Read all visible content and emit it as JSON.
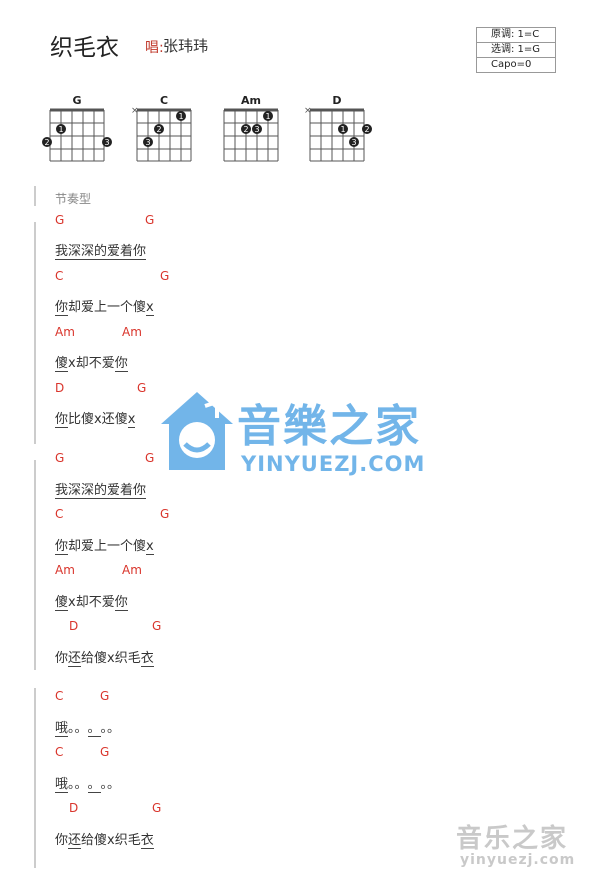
{
  "header": {
    "title": "织毛衣",
    "singer_prefix": "唱:",
    "singer": "张玮玮",
    "key_original": "原调: 1=C",
    "key_selected": "选调: 1=G",
    "capo": "Capo=0"
  },
  "chord_charts": [
    {
      "name": "G",
      "muted": "",
      "fingers": [
        "3",
        "1",
        "2",
        "3"
      ]
    },
    {
      "name": "C",
      "muted": "×",
      "fingers": [
        "1",
        "2",
        "3"
      ]
    },
    {
      "name": "Am",
      "muted": "",
      "fingers": [
        "1",
        "2",
        "3"
      ]
    },
    {
      "name": "D",
      "muted": "×",
      "fingers": [
        "1",
        "2",
        "3"
      ]
    }
  ],
  "section_label": "节奏型",
  "lines": [
    {
      "chords": [
        "G",
        "G"
      ],
      "lyric": [
        "我深深的爱着",
        "你"
      ]
    },
    {
      "chords": [
        "C",
        "G"
      ],
      "lyric": [
        "你",
        "却爱上一个傻",
        "x"
      ]
    },
    {
      "chords": [
        "Am",
        "Am"
      ],
      "lyric": [
        "傻",
        "x却不爱",
        "你"
      ]
    },
    {
      "chords": [
        "D",
        "G"
      ],
      "lyric": [
        "你",
        "比傻x还傻",
        "x"
      ]
    },
    {
      "chords": [
        "G",
        "G"
      ],
      "lyric": [
        "我深深的爱着",
        "你"
      ]
    },
    {
      "chords": [
        "C",
        "G"
      ],
      "lyric": [
        "你",
        "却爱上一个傻",
        "x"
      ]
    },
    {
      "chords": [
        "Am",
        "Am"
      ],
      "lyric": [
        "傻",
        "x却不爱",
        "你"
      ]
    },
    {
      "chords": [
        "D",
        "G"
      ],
      "lyric": [
        "你",
        "还",
        "给傻x织毛",
        "衣"
      ]
    },
    {
      "chords": [
        "C",
        "G"
      ],
      "lyric": [
        "哦",
        "。。",
        "。",
        "。。"
      ]
    },
    {
      "chords": [
        "C",
        "G"
      ],
      "lyric": [
        "哦",
        "。。",
        "。",
        "。。"
      ]
    },
    {
      "chords": [
        "D",
        "G"
      ],
      "lyric": [
        "你",
        "还",
        "给傻x织毛",
        "衣"
      ]
    }
  ],
  "watermark": {
    "cn": "音樂之家",
    "en": "YINYUEZJ.COM",
    "cn_small": "音乐之家",
    "en_small": "yinyuezj.com",
    "color": "#5aa9e6"
  }
}
